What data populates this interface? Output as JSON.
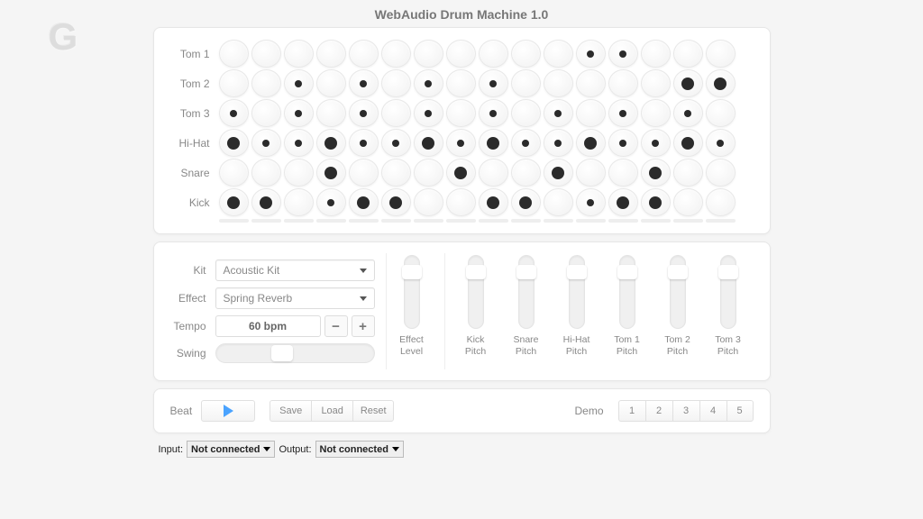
{
  "title": "WebAudio Drum Machine 1.0",
  "watermark": "G",
  "tracks": [
    {
      "label": "Tom 1",
      "steps": [
        0,
        0,
        0,
        0,
        0,
        0,
        0,
        0,
        0,
        0,
        0,
        1,
        1,
        0,
        0,
        0
      ]
    },
    {
      "label": "Tom 2",
      "steps": [
        0,
        0,
        1,
        0,
        1,
        0,
        1,
        0,
        1,
        0,
        0,
        0,
        0,
        0,
        2,
        2
      ]
    },
    {
      "label": "Tom 3",
      "steps": [
        1,
        0,
        1,
        0,
        1,
        0,
        1,
        0,
        1,
        0,
        1,
        0,
        1,
        0,
        1,
        0
      ]
    },
    {
      "label": "Hi-Hat",
      "steps": [
        2,
        1,
        1,
        2,
        1,
        1,
        2,
        1,
        2,
        1,
        1,
        2,
        1,
        1,
        2,
        1
      ]
    },
    {
      "label": "Snare",
      "steps": [
        0,
        0,
        0,
        2,
        0,
        0,
        0,
        2,
        0,
        0,
        2,
        0,
        0,
        2,
        0,
        0
      ]
    },
    {
      "label": "Kick",
      "steps": [
        2,
        2,
        0,
        1,
        2,
        2,
        0,
        0,
        2,
        2,
        0,
        1,
        2,
        2,
        0,
        0
      ]
    }
  ],
  "labels": {
    "kit": "Kit",
    "effect": "Effect",
    "tempo": "Tempo",
    "swing": "Swing",
    "beat": "Beat",
    "demo": "Demo",
    "save": "Save",
    "load": "Load",
    "reset": "Reset",
    "input": "Input:",
    "output": "Output:"
  },
  "kit_value": "Acoustic Kit",
  "effect_value": "Spring Reverb",
  "tempo_value": "60 bpm",
  "sliders": [
    {
      "label": "Effect\nLevel"
    },
    {
      "label": "Kick\nPitch"
    },
    {
      "label": "Snare\nPitch"
    },
    {
      "label": "Hi-Hat\nPitch"
    },
    {
      "label": "Tom 1\nPitch"
    },
    {
      "label": "Tom 2\nPitch"
    },
    {
      "label": "Tom 3\nPitch"
    }
  ],
  "demos": [
    "1",
    "2",
    "3",
    "4",
    "5"
  ],
  "io": {
    "input": "Not connected",
    "output": "Not connected"
  }
}
